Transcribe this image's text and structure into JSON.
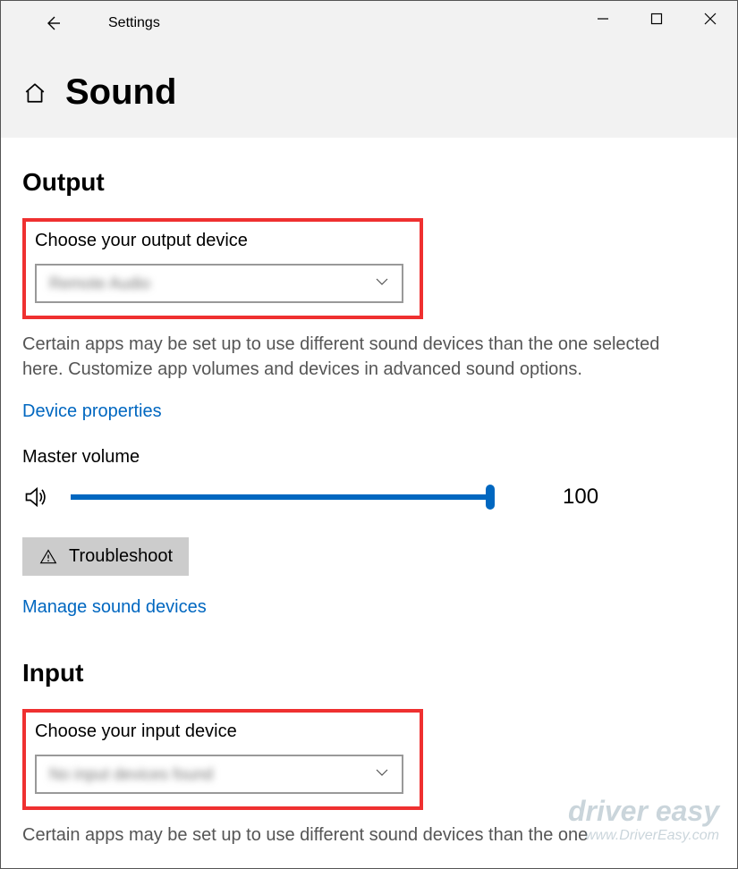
{
  "titlebar": {
    "title": "Settings"
  },
  "page": {
    "title": "Sound"
  },
  "output": {
    "heading": "Output",
    "choose_label": "Choose your output device",
    "selected_device": "Remote Audio",
    "description": "Certain apps may be set up to use different sound devices than the one selected here. Customize app volumes and devices in advanced sound options.",
    "device_properties_link": "Device properties",
    "master_volume_label": "Master volume",
    "master_volume_value": "100",
    "troubleshoot_label": "Troubleshoot",
    "manage_link": "Manage sound devices"
  },
  "input": {
    "heading": "Input",
    "choose_label": "Choose your input device",
    "selected_device": "No input devices found",
    "description": "Certain apps may be set up to use different sound devices than the one"
  },
  "watermark": {
    "line1": "driver easy",
    "line2": "www.DriverEasy.com"
  }
}
